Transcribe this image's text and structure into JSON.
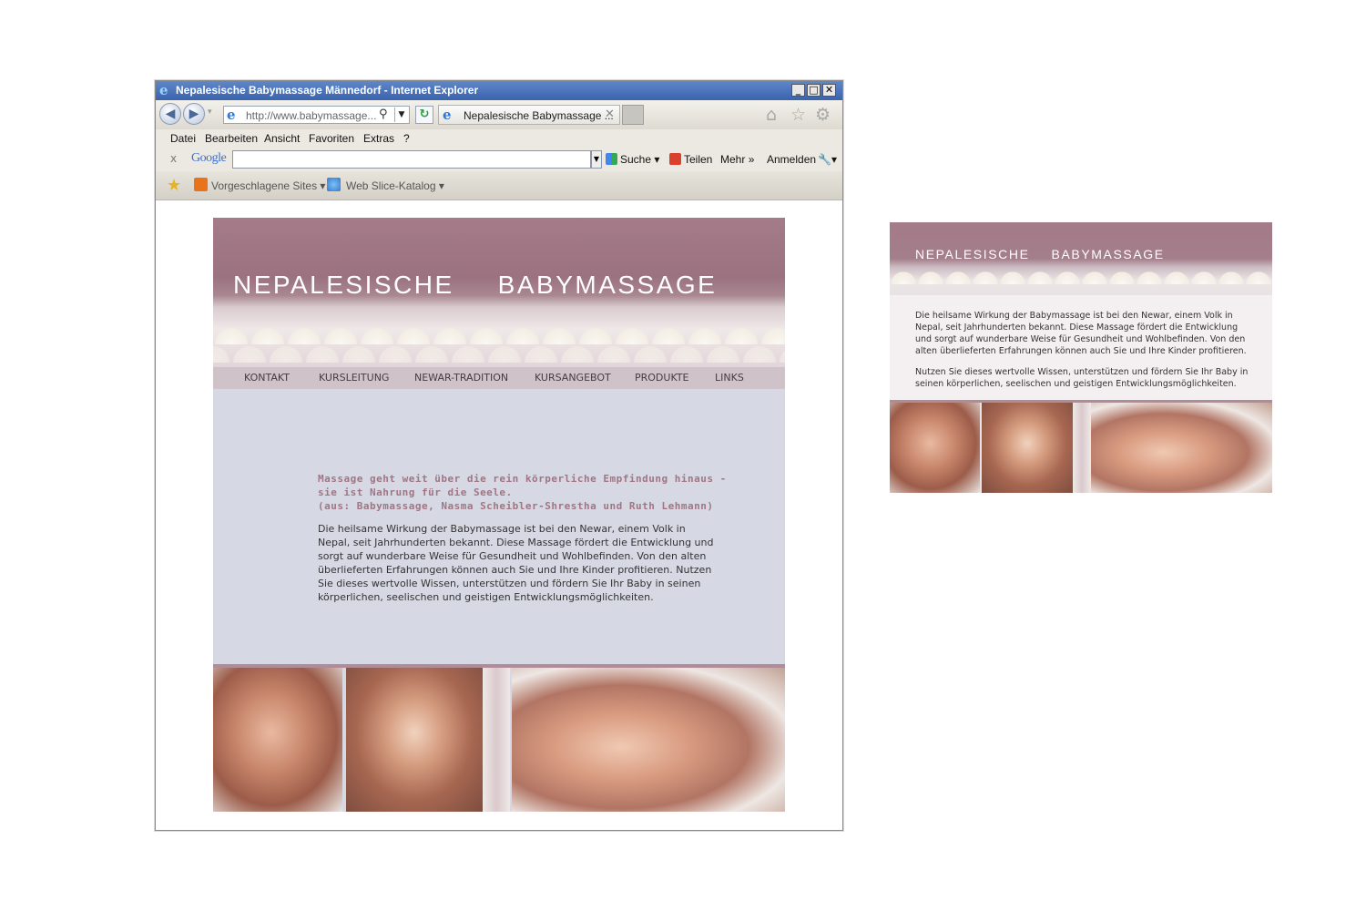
{
  "browser": {
    "window_title": "Nepalesische Babymassage Männedorf - Internet Explorer",
    "address": "http://www.babymassage...",
    "tab_title": "Nepalesische Babymassage ...",
    "menu": [
      "Datei",
      "Bearbeiten",
      "Ansicht",
      "Favoriten",
      "Extras",
      "?"
    ],
    "google_toolbar": {
      "close": "x",
      "logo": "Google",
      "search_value": "",
      "search_label": "Suche",
      "share_label": "Teilen",
      "more_label": "Mehr",
      "more_glyph": "»",
      "signin_label": "Anmelden"
    },
    "favorites_bar": {
      "suggested_sites": "Vorgeschlagene Sites",
      "web_slice": "Web Slice-Katalog"
    },
    "icons": [
      "ie-logo-icon",
      "back-icon",
      "forward-icon",
      "search-icon",
      "refresh-icon",
      "home-icon",
      "favorites-star-icon",
      "settings-gear-icon",
      "wrench-icon"
    ]
  },
  "site": {
    "header_word1": "NEPALESISCHE",
    "header_word2": "BABYMASSAGE",
    "nav": [
      "KONTAKT",
      "KURSLEITUNG",
      "NEWAR-TRADITION",
      "KURSANGEBOT",
      "PRODUKTE",
      "LINKS"
    ],
    "quote_line1": "Massage geht weit über die rein körperliche Empfindung hinaus -",
    "quote_line2": "sie ist Nahrung für die Seele.",
    "quote_line3": "(aus: Babymassage, Nasma Scheibler-Shrestha und Ruth Lehmann)",
    "body_text": "Die heilsame Wirkung der Babymassage ist bei den Newar, einem Volk in Nepal, seit Jahrhunderten bekannt. Diese Massage fördert die Entwicklung und sorgt auf wunderbare Weise für Gesundheit und Wohlbefinden. Von den alten überlieferten Erfahrungen können auch Sie und Ihre Kinder profitieren. Nutzen Sie dieses wertvolle Wissen, unterstützen und fördern Sie Ihr Baby in seinen körperlichen, seelischen und geistigen Entwicklungsmöglichkeiten."
  },
  "mockup": {
    "header_word1": "NEPALESISCHE",
    "header_word2": "BABYMASSAGE",
    "paragraph1": "Die heilsame Wirkung der Babymassage ist bei den Newar, einem Volk in Nepal, seit Jahrhunderten bekannt. Diese Massage fördert die Entwicklung und sorgt auf wunderbare Weise für Gesundheit und Wohlbefinden. Von den alten überlieferten Erfahrungen können auch Sie und Ihre Kinder profitieren.",
    "paragraph2": "Nutzen Sie dieses wertvolle Wissen, unterstützen und fördern Sie Ihr Baby in seinen körperlichen, seelischen und geistigen Entwicklungsmöglichkeiten."
  },
  "colors": {
    "accent_mauve": "#a47b88",
    "content_bg": "#d6d8e4",
    "quote_text": "#a17583",
    "title_bar": "#3a63ad"
  }
}
